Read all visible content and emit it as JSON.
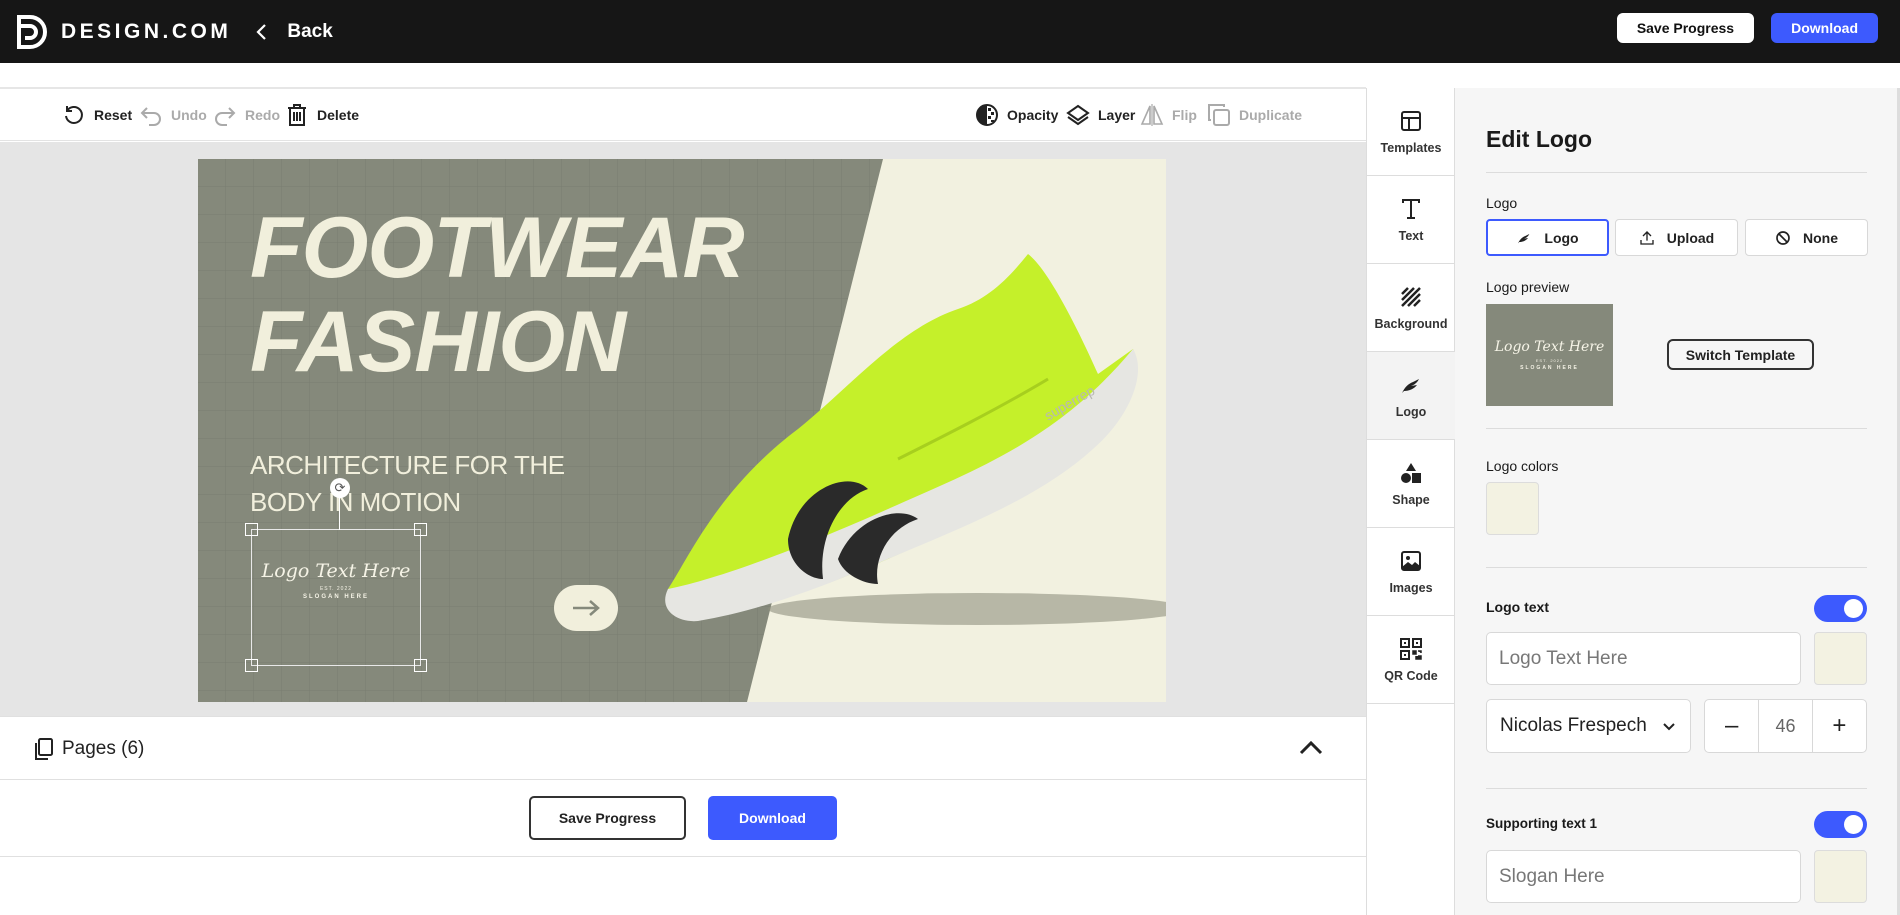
{
  "header": {
    "brand": "DESIGN.COM",
    "back_label": "Back",
    "save_progress_label": "Save Progress",
    "download_label": "Download"
  },
  "toolbar": {
    "reset": "Reset",
    "undo": "Undo",
    "redo": "Redo",
    "delete": "Delete",
    "opacity": "Opacity",
    "layer": "Layer",
    "flip": "Flip",
    "duplicate": "Duplicate"
  },
  "design": {
    "headline_line1": "FOOTWEAR",
    "headline_line2": "FASHION",
    "subhead_line1": "ARCHITECTURE FOR THE",
    "subhead_line2": "BODY IN MOTION",
    "logo_text": "Logo Text Here",
    "logo_est": "EST. 2022",
    "logo_slogan": "SLOGAN HERE",
    "shoe_brand": "superrep",
    "arrow": "→",
    "colors": {
      "background": "#85897b",
      "panel": "#f2f1e0",
      "shoe": "#c5f02a"
    }
  },
  "pages": {
    "label": "Pages (6)"
  },
  "bottom": {
    "save_progress_label": "Save Progress",
    "download_label": "Download"
  },
  "rail": {
    "items": [
      {
        "label": "Templates",
        "icon": "templates-icon"
      },
      {
        "label": "Text",
        "icon": "text-icon"
      },
      {
        "label": "Background",
        "icon": "background-icon"
      },
      {
        "label": "Logo",
        "icon": "logo-icon"
      },
      {
        "label": "Shape",
        "icon": "shape-icon"
      },
      {
        "label": "Images",
        "icon": "images-icon"
      },
      {
        "label": "QR Code",
        "icon": "qr-code-icon"
      }
    ]
  },
  "panel": {
    "title": "Edit Logo",
    "logo_label": "Logo",
    "options": {
      "logo": "Logo",
      "upload": "Upload",
      "none": "None"
    },
    "preview_label": "Logo preview",
    "switch_template": "Switch Template",
    "colors_label": "Logo colors",
    "logo_text_label": "Logo text",
    "logo_text_placeholder": "Logo Text Here",
    "font_name": "Nicolas Frespech",
    "font_size": "46",
    "minus": "–",
    "plus": "+",
    "supporting_text_label": "Supporting text 1",
    "supporting_text_placeholder": "Slogan Here",
    "accent": "#3d5afe",
    "swatch_color": "#f3f2e2"
  }
}
